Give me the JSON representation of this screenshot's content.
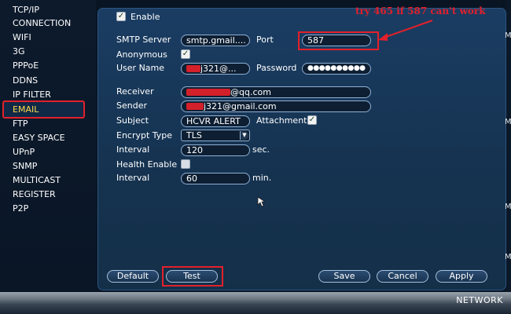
{
  "sidebar": {
    "items": [
      {
        "label": "TCP/IP"
      },
      {
        "label": "CONNECTION"
      },
      {
        "label": "WIFI"
      },
      {
        "label": "3G"
      },
      {
        "label": "PPPoE"
      },
      {
        "label": "DDNS"
      },
      {
        "label": "IP FILTER"
      },
      {
        "label": "EMAIL"
      },
      {
        "label": "FTP"
      },
      {
        "label": "EASY SPACE"
      },
      {
        "label": "UPnP"
      },
      {
        "label": "SNMP"
      },
      {
        "label": "MULTICAST"
      },
      {
        "label": "REGISTER"
      },
      {
        "label": "P2P"
      }
    ],
    "active": "EMAIL"
  },
  "form": {
    "enable_label": "Enable",
    "enable_checked": true,
    "smtp_server_label": "SMTP Server",
    "smtp_server_value": "smtp.gmail....",
    "port_label": "Port",
    "port_value": "587",
    "anonymous_label": "Anonymous",
    "anonymous_checked": true,
    "username_label": "User Name",
    "username_value": "j321@...",
    "password_label": "Password",
    "password_value": "●●●●●●●●●●",
    "receiver_label": "Receiver",
    "receiver_value": "@qq.com",
    "sender_label": "Sender",
    "sender_value": "j321@gmail.com",
    "subject_label": "Subject",
    "subject_value": "HCVR ALERT",
    "attachment_label": "Attachment",
    "attachment_checked": true,
    "encrypt_label": "Encrypt Type",
    "encrypt_value": "TLS",
    "interval_label": "Interval",
    "interval_value": "120",
    "interval_unit": "sec.",
    "health_label": "Health Enable",
    "health_checked": false,
    "health_interval_label": "Interval",
    "health_interval_value": "60",
    "health_interval_unit": "min."
  },
  "buttons": {
    "default": "Default",
    "test": "Test",
    "save": "Save",
    "cancel": "Cancel",
    "apply": "Apply"
  },
  "annotation": {
    "text": "try 465 if 587 can't work",
    "color": "#e3202b"
  },
  "footer": {
    "title": "NETWORK"
  },
  "icons": {
    "check": "check-icon",
    "dropdown": "chevron-down-icon",
    "cursor": "mouse-pointer-icon",
    "arrow": "annotation-arrow-icon"
  }
}
